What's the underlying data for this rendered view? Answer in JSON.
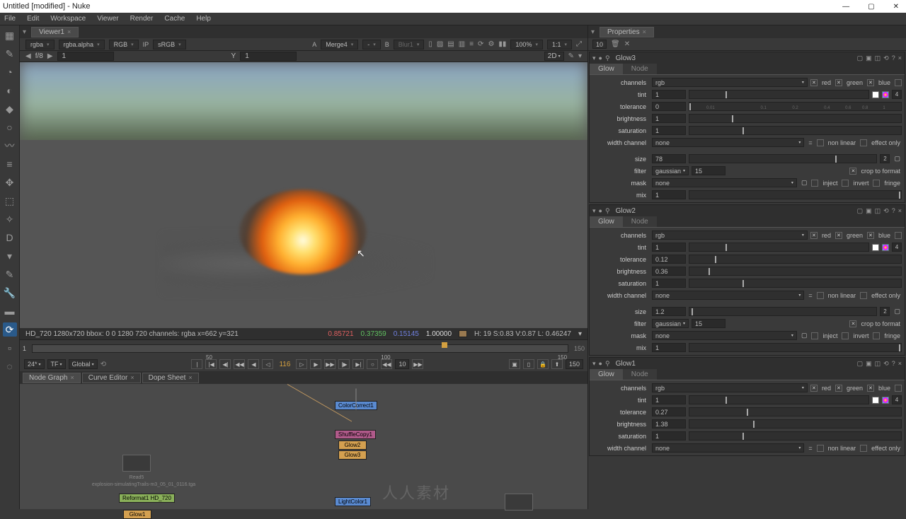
{
  "window": {
    "title": "Untitled [modified] - Nuke"
  },
  "menu": [
    "File",
    "Edit",
    "Workspace",
    "Viewer",
    "Render",
    "Cache",
    "Help"
  ],
  "viewer_tab": "Viewer1",
  "viewer_controls": {
    "channel_layer": "rgba",
    "channel_alpha": "rgba.alpha",
    "channel_view": "RGB",
    "ip": "IP",
    "colorspace": "sRGB",
    "a_label": "A",
    "a_node": "Merge4",
    "a_extra": "-",
    "b_label": "B",
    "b_node": "Blur1",
    "zoom": "100%",
    "ratio": "1:1",
    "view": "2D"
  },
  "fbar": {
    "f": "f/8",
    "arrow": "▶",
    "frame": "1",
    "y": "Y",
    "ybox": "1"
  },
  "status": {
    "left": "HD_720 1280x720  bbox: 0 0 1280 720 channels: rgba   x=662 y=321",
    "r": "0.85721",
    "g": "0.37359",
    "b": "0.15145",
    "a": "1.00000",
    "right": "H: 19 S:0.83 V:0.87  L: 0.46247"
  },
  "timeline": {
    "start": "1",
    "end": "150",
    "marks": [
      "50",
      "100",
      "150"
    ],
    "fps": "24*",
    "tf": "TF",
    "scope": "Global",
    "current": "116",
    "step": "10",
    "endframe": "150"
  },
  "graph_tabs": [
    "Node Graph",
    "Curve Editor",
    "Dope Sheet"
  ],
  "nodegraph": {
    "read5_file": "explosion-simulatingTrails-m3_05_01_0116.tga",
    "read5": "Read5",
    "reformat": "Reformat1\nHD_720",
    "glow1": "Glow1",
    "colorcorrect": "ColorCorrect1",
    "shufflecopy": "ShuffleCopy1",
    "glow2": "Glow2",
    "glow3": "Glow3",
    "lightcolor": "LightColor1"
  },
  "properties": {
    "tab": "Properties",
    "count": "10",
    "panels": [
      {
        "name": "Glow3",
        "tabs": [
          "Glow",
          "Node"
        ],
        "channels": "rgb",
        "tint": "1",
        "tolerance": "0",
        "brightness": "1",
        "saturation": "1",
        "width_channel": "none",
        "size": "78",
        "filter": "gaussian",
        "filter_iter": "15",
        "mask": "none",
        "mix": "1",
        "crop": "crop to format",
        "nonlinear": "non linear",
        "effectonly": "effect only",
        "inject": "inject",
        "invert": "invert",
        "fringe": "fringe",
        "rgb": {
          "r": "red",
          "g": "green",
          "b": "blue"
        },
        "two": "2",
        "four": "4"
      },
      {
        "name": "Glow2",
        "tabs": [
          "Glow",
          "Node"
        ],
        "channels": "rgb",
        "tint": "1",
        "tolerance": "0.12",
        "brightness": "0.36",
        "saturation": "1",
        "width_channel": "none",
        "size": "1.2",
        "filter": "gaussian",
        "filter_iter": "15",
        "mask": "none",
        "mix": "1",
        "crop": "crop to format",
        "nonlinear": "non linear",
        "effectonly": "effect only",
        "inject": "inject",
        "invert": "invert",
        "fringe": "fringe",
        "rgb": {
          "r": "red",
          "g": "green",
          "b": "blue"
        },
        "two": "2",
        "four": "4"
      },
      {
        "name": "Glow1",
        "tabs": [
          "Glow",
          "Node"
        ],
        "channels": "rgb",
        "tint": "1",
        "tolerance": "0.27",
        "brightness": "1.38",
        "saturation": "1",
        "width_channel": "none",
        "rgb": {
          "r": "red",
          "g": "green",
          "b": "blue"
        },
        "nonlinear": "non linear",
        "effectonly": "effect only",
        "four": "4"
      }
    ],
    "labels": {
      "channels": "channels",
      "tint": "tint",
      "tolerance": "tolerance",
      "brightness": "brightness",
      "saturation": "saturation",
      "width_channel": "width channel",
      "size": "size",
      "filter": "filter",
      "mask": "mask",
      "mix": "mix"
    }
  },
  "watermark": "人人素材"
}
